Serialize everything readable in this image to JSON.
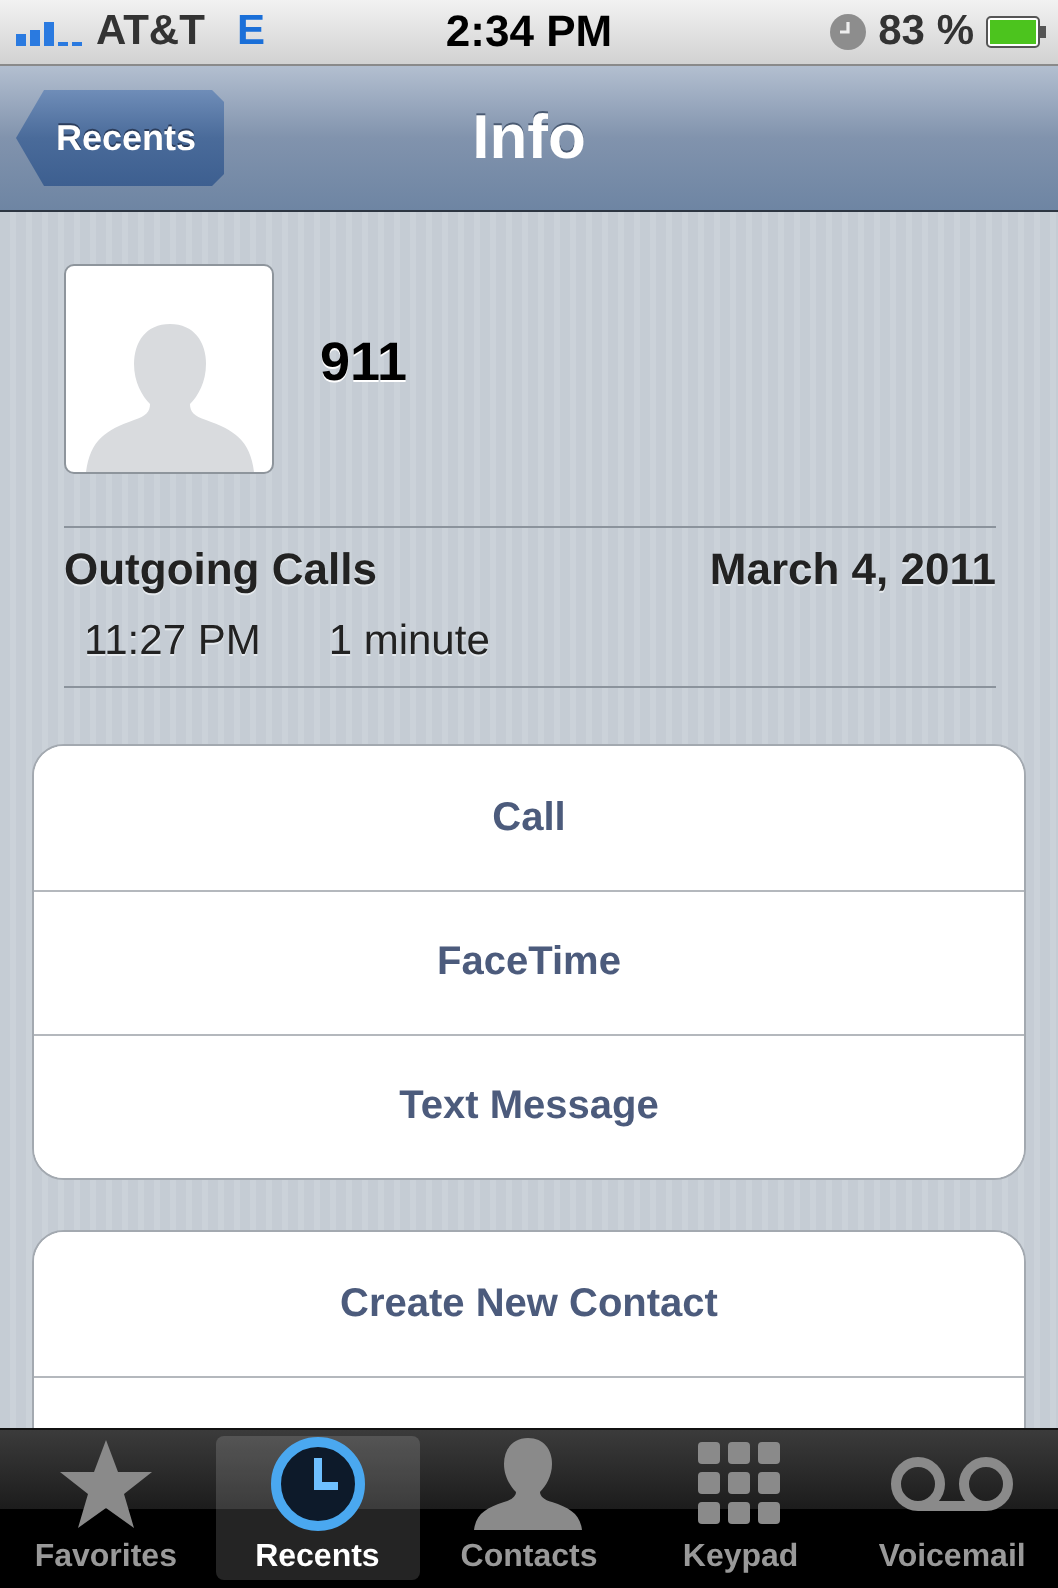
{
  "status_bar": {
    "carrier": "AT&T",
    "network": "E",
    "time": "2:34 PM",
    "battery": "83 %"
  },
  "nav_bar": {
    "back": "Recents",
    "title": "Info"
  },
  "contact": {
    "name": "911"
  },
  "call_log": {
    "heading": "Outgoing Calls",
    "date": "March 4, 2011",
    "entries": [
      {
        "time": "11:27 PM",
        "duration": "1 minute"
      }
    ]
  },
  "action_groups": [
    {
      "buttons": [
        "Call",
        "FaceTime",
        "Text Message"
      ]
    },
    {
      "buttons": [
        "Create New Contact"
      ]
    }
  ],
  "tab_bar": [
    {
      "kind": "favorites",
      "label": "Favorites",
      "selected": false
    },
    {
      "kind": "recents",
      "label": "Recents",
      "selected": true
    },
    {
      "kind": "contacts",
      "label": "Contacts",
      "selected": false
    },
    {
      "kind": "keypad",
      "label": "Keypad",
      "selected": false
    },
    {
      "kind": "voicemail",
      "label": "Voicemail",
      "selected": false
    }
  ]
}
